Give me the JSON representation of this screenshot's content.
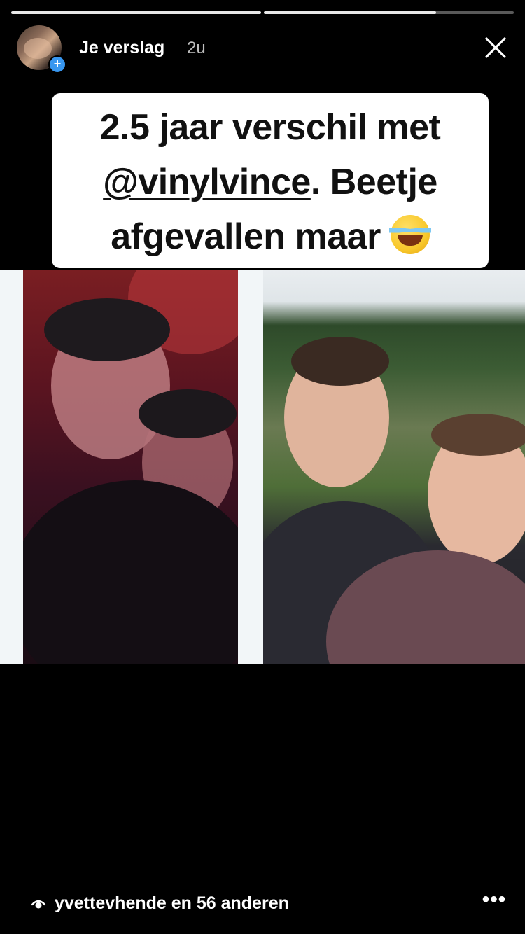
{
  "story": {
    "progress": [
      1.0,
      0.69
    ],
    "account_label": "Je verslag",
    "time_ago": "2u",
    "caption": {
      "line1": "2.5 jaar verschil met",
      "mention": "@vinylvince",
      "line2_rest": ". Beetje",
      "line3": "afgevallen maar",
      "emoji": "face-with-tears-of-joy"
    },
    "viewers_text": "yvettevhende en 56 anderen"
  },
  "icons": {
    "add": "plus-badge-icon",
    "close": "close-icon",
    "views": "eye-icon",
    "more": "more-icon"
  },
  "colors": {
    "background": "#000000",
    "caption_bg": "#ffffff",
    "badge_blue": "#3897f0"
  }
}
